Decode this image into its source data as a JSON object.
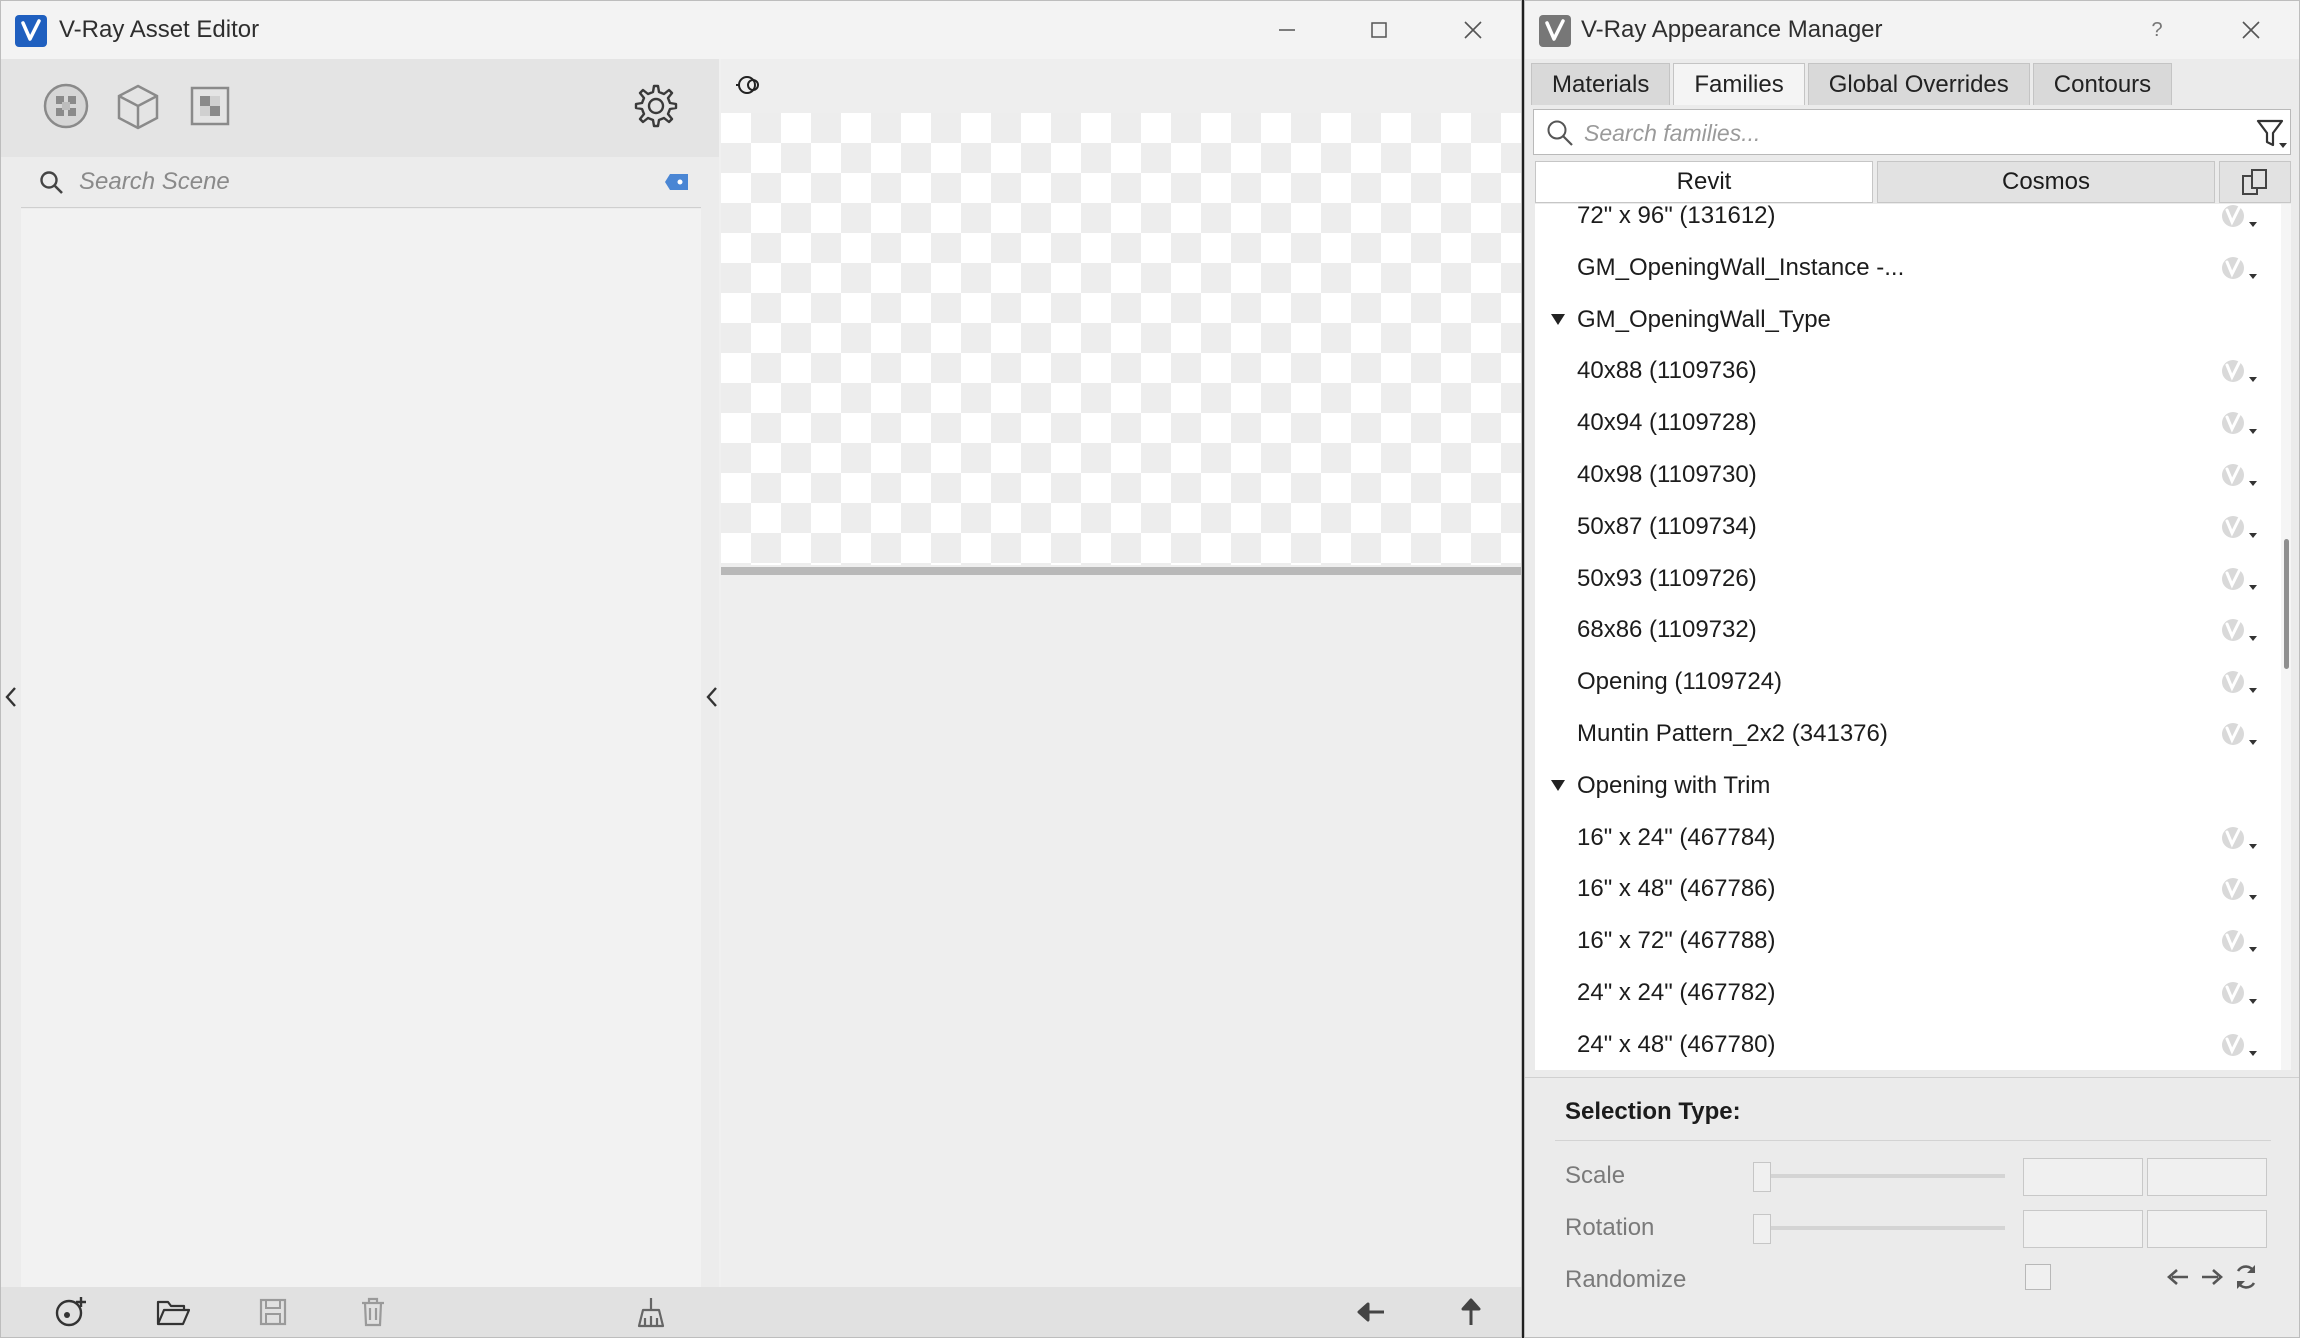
{
  "asset_editor": {
    "title": "V-Ray Asset Editor",
    "search_placeholder": "Search Scene"
  },
  "appearance_manager": {
    "title": "V-Ray Appearance Manager",
    "help": "?",
    "tabs": [
      {
        "label": "Materials",
        "active": false
      },
      {
        "label": "Families",
        "active": true
      },
      {
        "label": "Global Overrides",
        "active": false
      },
      {
        "label": "Contours",
        "active": false
      }
    ],
    "search_placeholder": "Search families...",
    "subtabs": [
      {
        "label": "Revit",
        "active": true
      },
      {
        "label": "Cosmos",
        "active": false
      }
    ],
    "tree": [
      {
        "label": "72\" x 96\" (131612)",
        "level": 1,
        "group": false
      },
      {
        "label": "GM_OpeningWall_Instance -...",
        "level": 1,
        "group": false
      },
      {
        "label": "GM_OpeningWall_Type",
        "level": 0,
        "group": true
      },
      {
        "label": "40x88 (1109736)",
        "level": 1,
        "group": false
      },
      {
        "label": "40x94 (1109728)",
        "level": 1,
        "group": false
      },
      {
        "label": "40x98 (1109730)",
        "level": 1,
        "group": false
      },
      {
        "label": "50x87 (1109734)",
        "level": 1,
        "group": false
      },
      {
        "label": "50x93 (1109726)",
        "level": 1,
        "group": false
      },
      {
        "label": "68x86 (1109732)",
        "level": 1,
        "group": false
      },
      {
        "label": "Opening (1109724)",
        "level": 1,
        "group": false
      },
      {
        "label": "Muntin Pattern_2x2 (341376)",
        "level": 1,
        "group": false
      },
      {
        "label": "Opening with Trim",
        "level": 0,
        "group": true
      },
      {
        "label": "16\" x 24\" (467784)",
        "level": 1,
        "group": false
      },
      {
        "label": "16\" x 48\" (467786)",
        "level": 1,
        "group": false
      },
      {
        "label": "16\" x 72\" (467788)",
        "level": 1,
        "group": false
      },
      {
        "label": "24\" x 24\" (467782)",
        "level": 1,
        "group": false
      },
      {
        "label": "24\" x 48\" (467780)",
        "level": 1,
        "group": false
      }
    ],
    "selection": {
      "title": "Selection Type:",
      "scale_label": "Scale",
      "rotation_label": "Rotation",
      "randomize_label": "Randomize"
    }
  },
  "colors": {
    "vray_blue": "#1f5fbf",
    "accent_blue": "#4a86d4"
  }
}
